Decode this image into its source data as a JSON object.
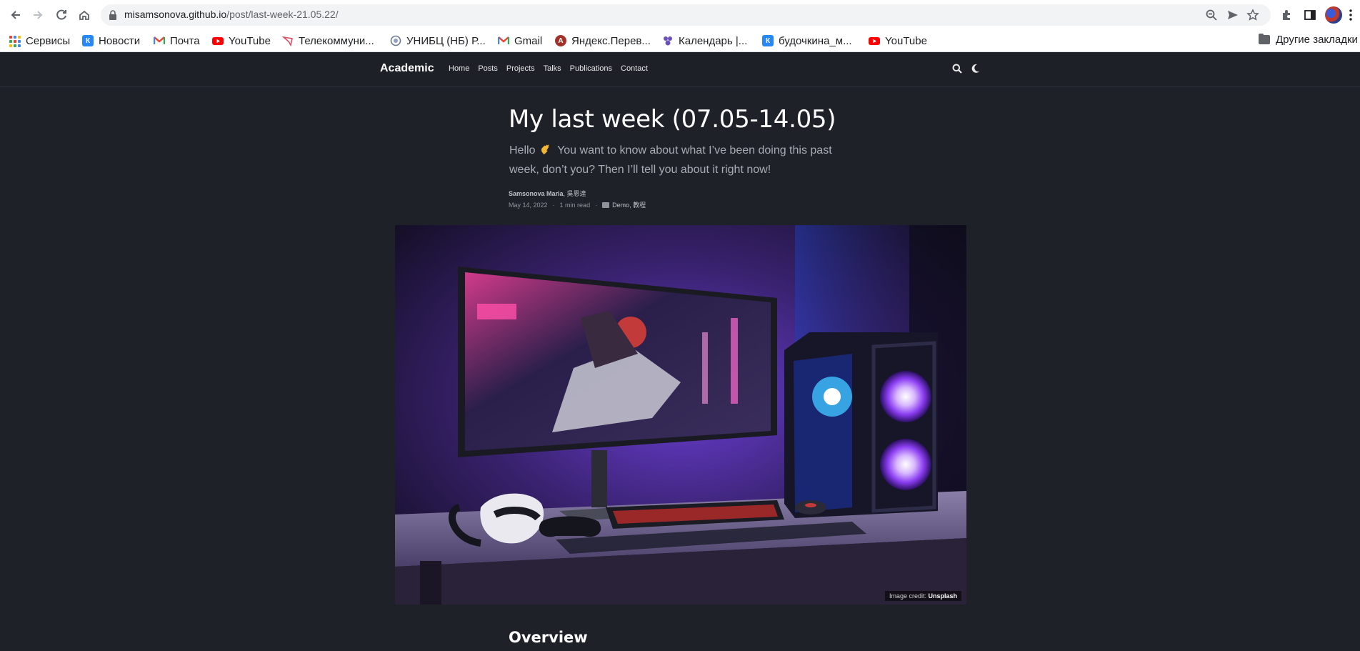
{
  "browser": {
    "url_host": "misamsonova.github.io",
    "url_path": "/post/last-week-21.05.22/",
    "bookmarks": [
      {
        "label": "Сервисы",
        "icon": "apps-grid-icon"
      },
      {
        "label": "Новости",
        "icon": "vk-icon"
      },
      {
        "label": "Почта",
        "icon": "gmail-icon"
      },
      {
        "label": "YouTube",
        "icon": "youtube-icon"
      },
      {
        "label": "Телекоммуни...",
        "icon": "telecom-icon"
      },
      {
        "label": "УНИБЦ (НБ) Р...",
        "icon": "unibc-icon"
      },
      {
        "label": "Gmail",
        "icon": "gmail-icon"
      },
      {
        "label": "Яндекс.Перев...",
        "icon": "yandex-translate-icon"
      },
      {
        "label": "Календарь |...",
        "icon": "calendar-icon"
      },
      {
        "label": "будочкина_м...",
        "icon": "vk-icon"
      },
      {
        "label": "YouTube",
        "icon": "youtube-icon"
      }
    ],
    "other_bookmarks": "Другие закладки"
  },
  "site": {
    "brand": "Academic",
    "nav": [
      "Home",
      "Posts",
      "Projects",
      "Talks",
      "Publications",
      "Contact"
    ]
  },
  "post": {
    "title": "My last week (07.05-14.05)",
    "summary_before": "Hello",
    "summary_after": "You want to know about what I’ve been doing this past week, don’t you? Then I’ll tell you about it right now!",
    "author": "Samsonova Maria",
    "coauthor": ", 吳恩達",
    "date": "May 14, 2022",
    "read_time": "1 min read",
    "categories": "Demo, 教程",
    "image_credit_label": "Image credit:",
    "image_credit_source": "Unsplash",
    "section_heading": "Overview"
  },
  "colors": {
    "site_bg": "#1f2128",
    "chrome_bg": "#ffffff",
    "omnibox_bg": "#f1f3f4"
  }
}
